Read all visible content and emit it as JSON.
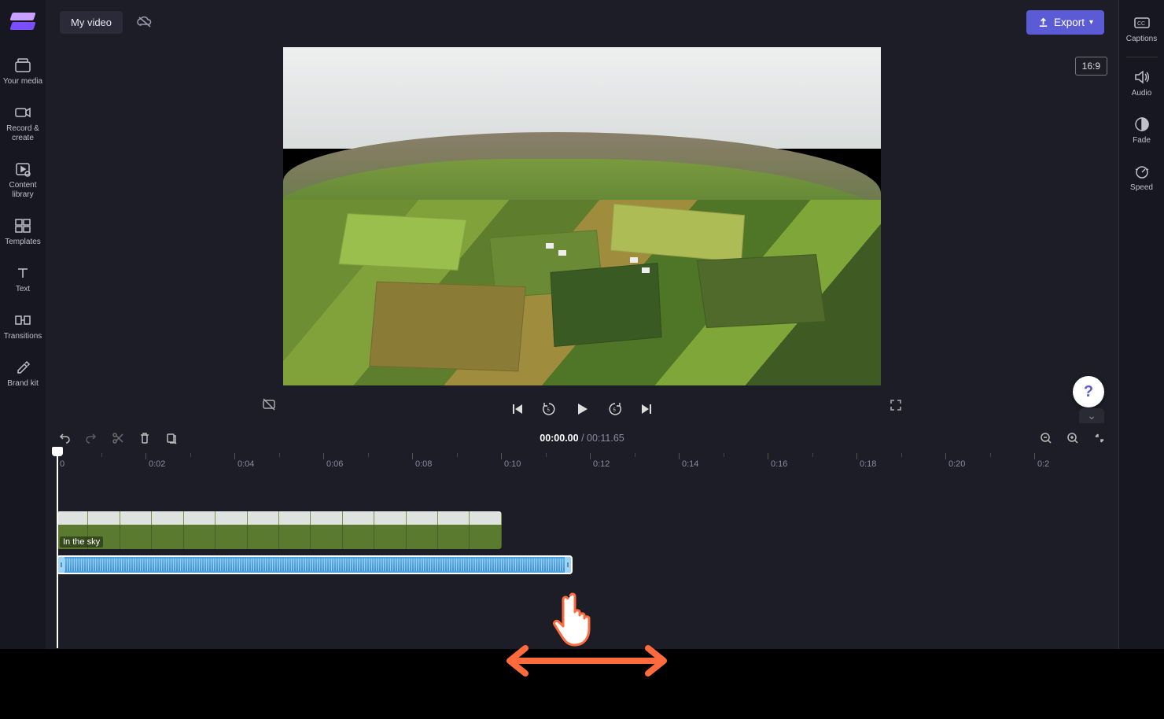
{
  "app": {
    "project_title": "My video"
  },
  "left_sidebar": {
    "items": [
      {
        "label": "Your media"
      },
      {
        "label": "Record & create"
      },
      {
        "label": "Content library"
      },
      {
        "label": "Templates"
      },
      {
        "label": "Text"
      },
      {
        "label": "Transitions"
      },
      {
        "label": "Brand kit"
      }
    ]
  },
  "right_sidebar": {
    "items": [
      {
        "label": "Captions"
      },
      {
        "label": "Audio"
      },
      {
        "label": "Fade"
      },
      {
        "label": "Speed"
      }
    ]
  },
  "topbar": {
    "export_label": "Export"
  },
  "preview": {
    "aspect_ratio": "16:9"
  },
  "timeline": {
    "current_time": "00:00.00",
    "separator": " / ",
    "duration": "00:11.65",
    "ruler_labels": [
      "0",
      "0:02",
      "0:04",
      "0:06",
      "0:08",
      "0:10",
      "0:12",
      "0:14",
      "0:16",
      "0:18",
      "0:20",
      "0:2"
    ],
    "video_clip": {
      "label": "In the sky"
    }
  },
  "colors": {
    "accent": "#5b5bd6",
    "audio_track": "#4aa3e0",
    "annotation": "#ff6b3d"
  }
}
